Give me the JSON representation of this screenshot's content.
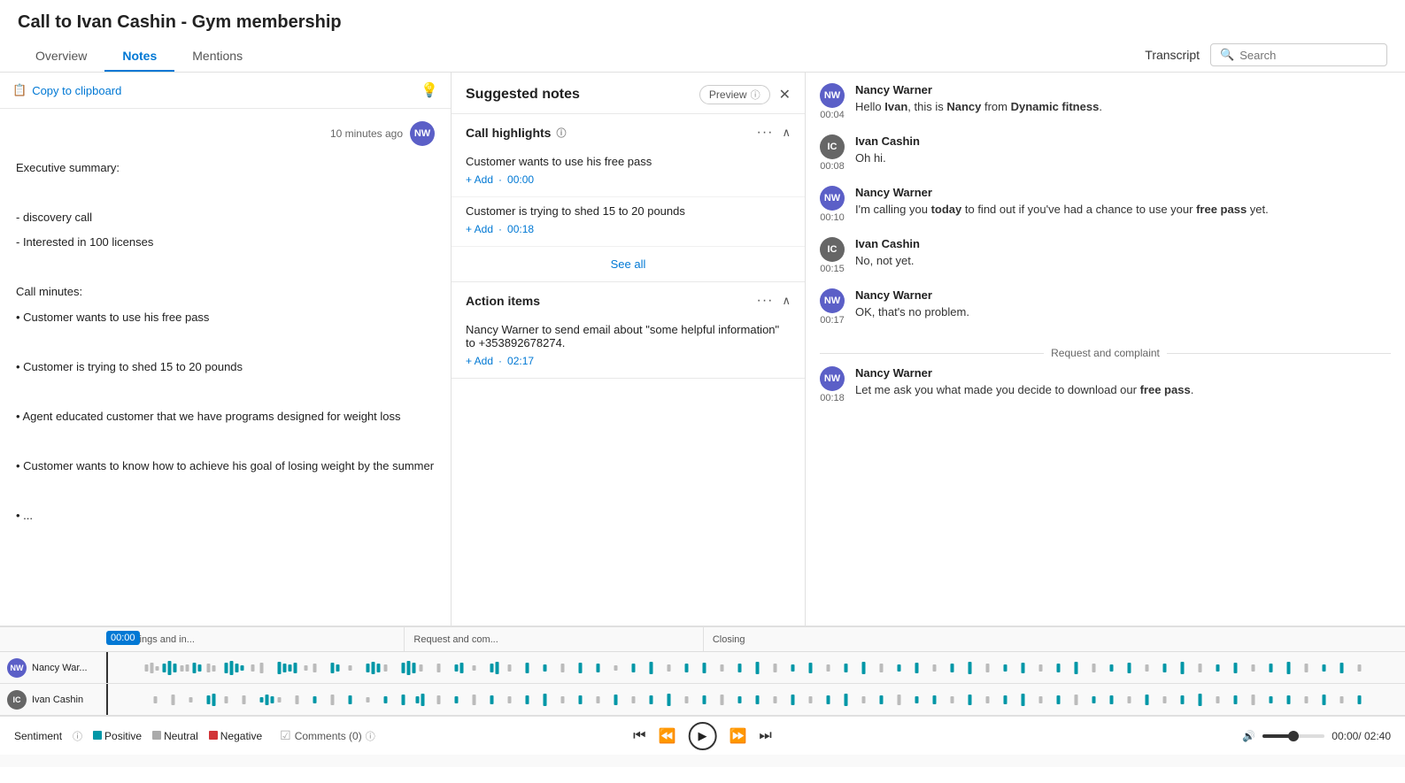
{
  "page": {
    "title": "Call to Ivan Cashin - Gym membership"
  },
  "tabs": [
    {
      "id": "overview",
      "label": "Overview",
      "active": false
    },
    {
      "id": "notes",
      "label": "Notes",
      "active": true
    },
    {
      "id": "mentions",
      "label": "Mentions",
      "active": false
    }
  ],
  "right_header": {
    "transcript_label": "Transcript",
    "search_placeholder": "Search"
  },
  "left_panel": {
    "copy_label": "Copy to clipboard",
    "timestamp": "10 minutes ago",
    "avatar": "NW",
    "notes_content": [
      "Executive summary:",
      "",
      "- discovery call",
      "- Interested in 100 licenses",
      "",
      "Call minutes:",
      "• Customer wants to use his free pass",
      "",
      "• Customer is trying to shed 15 to 20 pounds",
      "",
      "• Agent educated customer that we have programs designed for weight loss",
      "",
      "• Customer wants to know how to achieve his goal of losing weight by the summer",
      "",
      "• ..."
    ]
  },
  "suggested_notes": {
    "title": "Suggested notes",
    "preview_label": "Preview",
    "sections": [
      {
        "id": "call-highlights",
        "title": "Call highlights",
        "items": [
          {
            "text": "Customer wants to use his free pass",
            "add_label": "+ Add",
            "time": "00:00"
          },
          {
            "text": "Customer is trying to shed 15 to 20 pounds",
            "add_label": "+ Add",
            "time": "00:18"
          }
        ],
        "see_all_label": "See all"
      },
      {
        "id": "action-items",
        "title": "Action items",
        "items": [
          {
            "text": "Nancy Warner to send email about \"some helpful information\" to +353892678274.",
            "add_label": "+ Add",
            "time": "02:17"
          }
        ]
      }
    ]
  },
  "transcript": {
    "entries": [
      {
        "speaker": "Nancy Warner",
        "avatar": "NW",
        "avatar_class": "avatar-nw",
        "time": "00:04",
        "text": "Hello <b>Ivan</b>, this is <b>Nancy</b> from <b>Dynamic fitness</b>.",
        "has_bold": true
      },
      {
        "speaker": "Ivan Cashin",
        "avatar": "IC",
        "avatar_class": "avatar-ic",
        "time": "00:08",
        "text": "Oh hi.",
        "has_bold": false
      },
      {
        "speaker": "Nancy Warner",
        "avatar": "NW",
        "avatar_class": "avatar-nw",
        "time": "00:10",
        "text": "I'm calling you <b>today</b> to find out if you've had a chance to use your <b>free pass</b> yet.",
        "has_bold": true
      },
      {
        "speaker": "Ivan Cashin",
        "avatar": "IC",
        "avatar_class": "avatar-ic",
        "time": "00:15",
        "text": "No, not yet.",
        "has_bold": false
      },
      {
        "speaker": "Nancy Warner",
        "avatar": "NW",
        "avatar_class": "avatar-nw",
        "time": "00:17",
        "text": "OK, that's no problem.",
        "has_bold": false
      },
      {
        "divider": "Request and complaint"
      },
      {
        "speaker": "Nancy Warner",
        "avatar": "NW",
        "avatar_class": "avatar-nw",
        "time": "00:18",
        "text": "Let me ask you what made you decide to download our <b>free pass</b>.",
        "has_bold": true
      }
    ]
  },
  "timeline": {
    "segments": [
      {
        "label": "Greetings and in...",
        "width": "23%"
      },
      {
        "label": "Request and com...",
        "width": "23%"
      },
      {
        "label": "Closing",
        "width": "54%"
      }
    ],
    "speakers": [
      {
        "name": "Nancy War...",
        "avatar": "NW",
        "avatar_class": "avatar-nw"
      },
      {
        "name": "Ivan Cashin",
        "avatar": "IC",
        "avatar_class": "avatar-ic"
      }
    ],
    "playhead_time": "00:00"
  },
  "bottom_controls": {
    "sentiment_label": "Sentiment",
    "positive_label": "Positive",
    "neutral_label": "Neutral",
    "negative_label": "Negative",
    "comments_label": "Comments (0)",
    "current_time": "00:00",
    "total_time": "02:40"
  }
}
